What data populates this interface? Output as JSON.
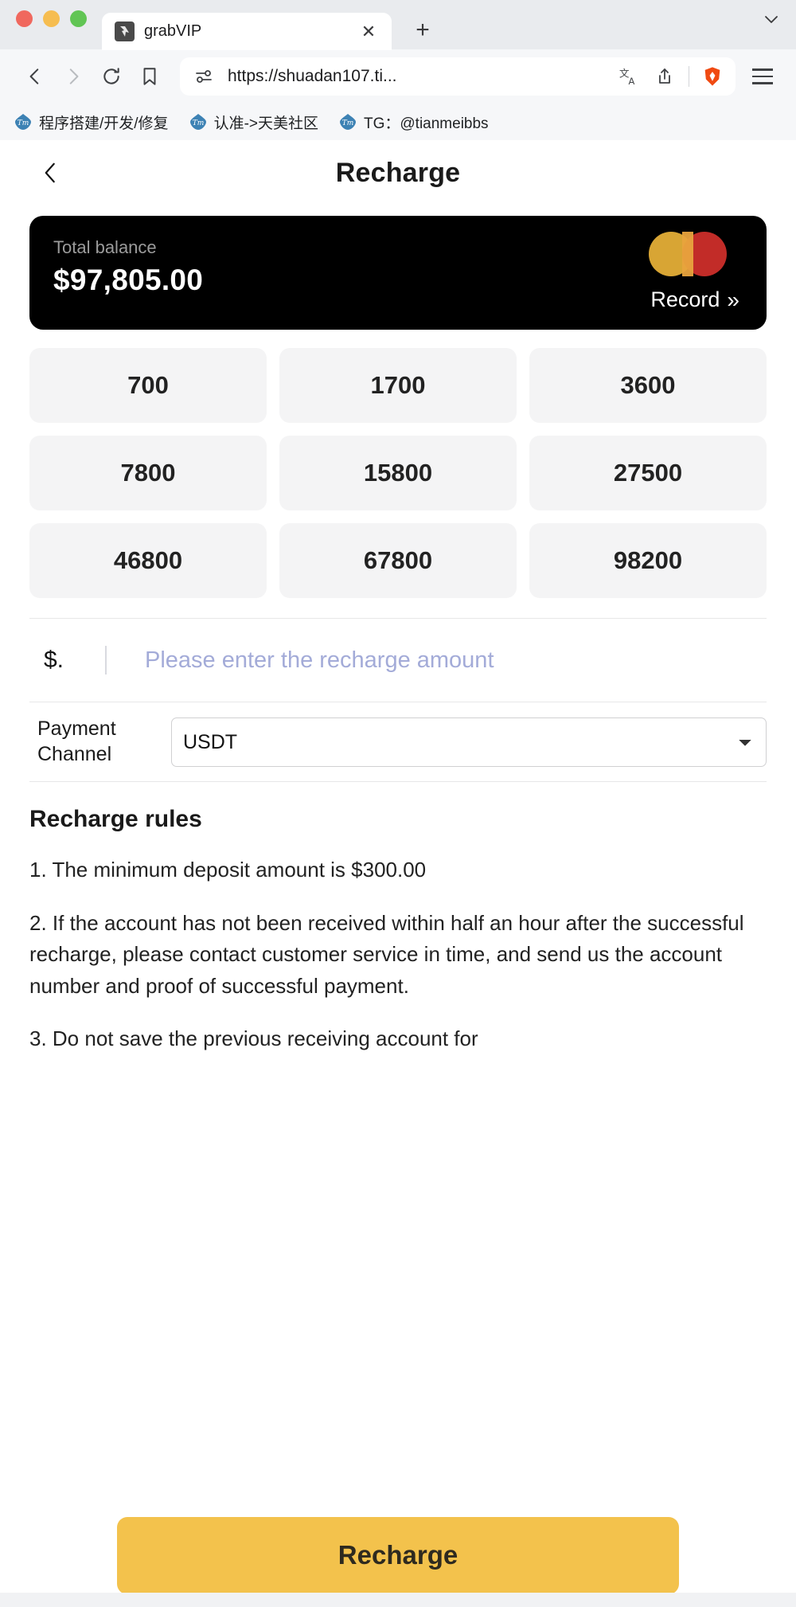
{
  "browser": {
    "tab": {
      "title": "grabVIP",
      "favicon_icon": "grabvip-favicon",
      "close_icon": "close-icon"
    },
    "new_tab_icon": "plus-icon",
    "tab_list_icon": "chevron-down-icon",
    "nav": {
      "back_icon": "back-arrow-icon",
      "forward_icon": "forward-arrow-icon",
      "reload_icon": "reload-icon",
      "bookmark_icon": "bookmark-icon"
    },
    "omnibox": {
      "permissions_icon": "site-settings-icon",
      "url": "https://shuadan107.ti...",
      "translate_icon": "translate-icon",
      "share_icon": "share-icon",
      "brave_icon": "brave-shield-icon"
    },
    "menu_icon": "hamburger-menu-icon",
    "bookmarks": [
      {
        "icon": "tianmei-icon",
        "label": "程序搭建/开发/修复"
      },
      {
        "icon": "tianmei-icon",
        "label": "认准->天美社区"
      },
      {
        "icon": "tianmei-icon",
        "label": "TG：@tianmeibbs"
      }
    ]
  },
  "page": {
    "back_icon": "chevron-left-icon",
    "title": "Recharge",
    "balance_card": {
      "label": "Total balance",
      "amount": "$97,805.00",
      "brand_icon": "mastercard-icon",
      "record_label": "Record",
      "record_chevrons": "»"
    },
    "amounts": [
      "700",
      "1700",
      "3600",
      "7800",
      "15800",
      "27500",
      "46800",
      "67800",
      "98200"
    ],
    "amount_input": {
      "currency_prefix": "$.",
      "value": "",
      "placeholder": "Please enter the recharge amount"
    },
    "payment_channel": {
      "label": "Payment Channel",
      "selected": "USDT",
      "options": [
        "USDT"
      ],
      "chevron_icon": "chevron-down-icon"
    },
    "rules": {
      "title": "Recharge rules",
      "items": [
        "1. The minimum deposit amount is $300.00",
        "2. If the account has not been received within half an hour after the successful recharge, please contact customer service in time, and send us the account number and proof of successful payment.",
        "3. Do not save the previous receiving account for"
      ]
    },
    "cta": {
      "label": "Recharge",
      "color": "#F3C24C"
    }
  }
}
